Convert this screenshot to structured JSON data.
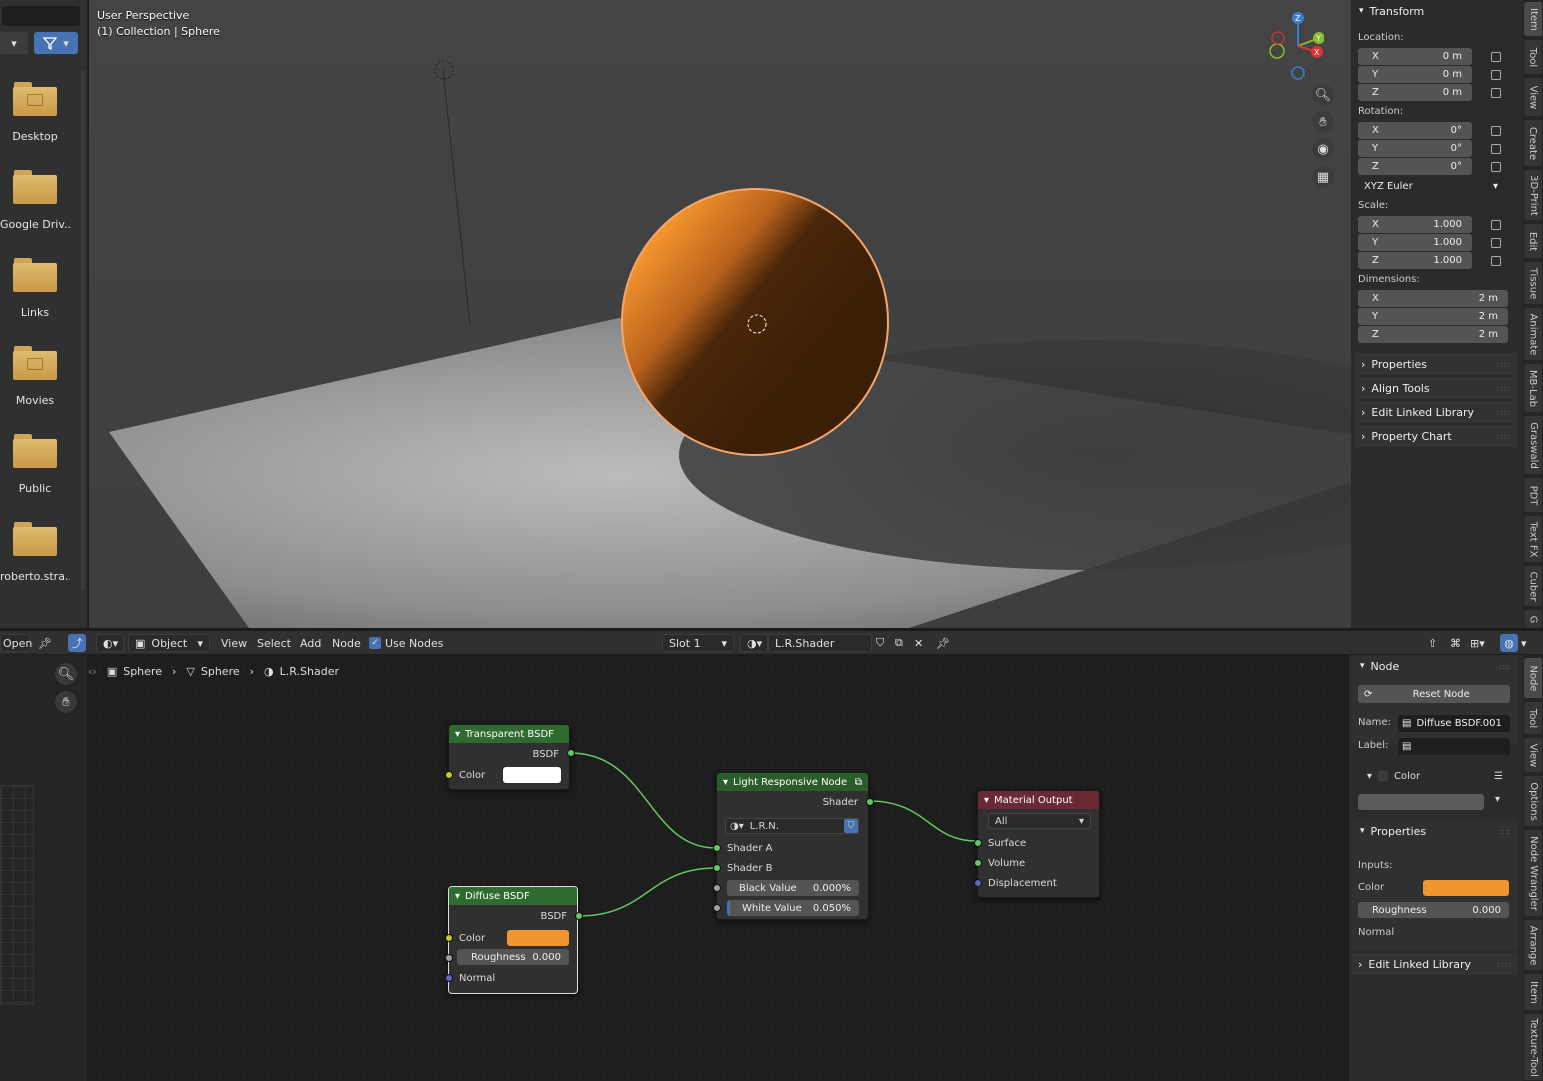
{
  "file_browser": {
    "folders": [
      {
        "label": "Desktop"
      },
      {
        "label": "Google Driv..."
      },
      {
        "label": "Links"
      },
      {
        "label": "Movies"
      },
      {
        "label": "Public"
      },
      {
        "label": "roberto.stra..."
      }
    ]
  },
  "viewport": {
    "title": "User Perspective",
    "subtitle": "(1) Collection | Sphere",
    "gizmo": {
      "z": "Z",
      "y": "Y",
      "x": "X"
    },
    "colors": {
      "sphere": "#f08a25",
      "plane": "#bdbdbd",
      "selection": "#f3a76a"
    }
  },
  "transform_panel": {
    "header": "Transform",
    "location_label": "Location:",
    "location": [
      {
        "axis": "X",
        "value": "0 m"
      },
      {
        "axis": "Y",
        "value": "0 m"
      },
      {
        "axis": "Z",
        "value": "0 m"
      }
    ],
    "rotation_label": "Rotation:",
    "rotation": [
      {
        "axis": "X",
        "value": "0°"
      },
      {
        "axis": "Y",
        "value": "0°"
      },
      {
        "axis": "Z",
        "value": "0°"
      }
    ],
    "rotation_mode": "XYZ Euler",
    "scale_label": "Scale:",
    "scale": [
      {
        "axis": "X",
        "value": "1.000"
      },
      {
        "axis": "Y",
        "value": "1.000"
      },
      {
        "axis": "Z",
        "value": "1.000"
      }
    ],
    "dimensions_label": "Dimensions:",
    "dimensions": [
      {
        "axis": "X",
        "value": "2 m"
      },
      {
        "axis": "Y",
        "value": "2 m"
      },
      {
        "axis": "Z",
        "value": "2 m"
      }
    ],
    "collapsed": [
      "Properties",
      "Align Tools",
      "Edit Linked Library",
      "Property Chart"
    ]
  },
  "top_tabs": [
    "Item",
    "Tool",
    "View",
    "Create",
    "3D-Print",
    "Edit",
    "Tissue",
    "Animate",
    "MB-Lab",
    "Graswald",
    "PDT",
    "Text FX",
    "Cuber",
    "G"
  ],
  "node_header": {
    "open": "Open",
    "object_mode": "Object",
    "menus": [
      "View",
      "Select",
      "Add",
      "Node"
    ],
    "use_nodes": "Use Nodes",
    "slot": "Slot 1",
    "material": "L.R.Shader"
  },
  "breadcrumb": {
    "object": "Sphere",
    "mesh": "Sphere",
    "material": "L.R.Shader"
  },
  "nodes": {
    "transparent": {
      "title": "Transparent BSDF",
      "output": "BSDF",
      "color_label": "Color"
    },
    "diffuse": {
      "title": "Diffuse BSDF",
      "output": "BSDF",
      "color_label": "Color",
      "roughness_label": "Roughness",
      "roughness_value": "0.000",
      "normal_label": "Normal"
    },
    "lrn": {
      "title": "Light Responsive Node",
      "output": "Shader",
      "group_name": "L.R.N.",
      "shader_a": "Shader A",
      "shader_b": "Shader B",
      "black_label": "Black Value",
      "black_value": "0.000%",
      "white_label": "White Value",
      "white_value": "0.050%"
    },
    "output": {
      "title": "Material Output",
      "target": "All",
      "surface": "Surface",
      "volume": "Volume",
      "displacement": "Displacement"
    }
  },
  "node_panel": {
    "header": "Node",
    "reset": "Reset Node",
    "name_label": "Name:",
    "name_value": "Diffuse BSDF.001",
    "label_label": "Label:",
    "color_section": "Color",
    "properties_header": "Properties",
    "inputs_label": "Inputs:",
    "color_label": "Color",
    "roughness_label": "Roughness",
    "roughness_value": "0.000",
    "normal_label": "Normal",
    "edit_linked": "Edit Linked Library"
  },
  "bottom_tabs": [
    "Node",
    "Tool",
    "View",
    "Options",
    "Node Wrangler",
    "Arrange",
    "Item",
    "Texture-Tool"
  ],
  "colors": {
    "orange": "#f2952f",
    "green_header": "#2f6a2f",
    "output_header": "#6a2a33",
    "group_header": "#2b5d2b"
  }
}
